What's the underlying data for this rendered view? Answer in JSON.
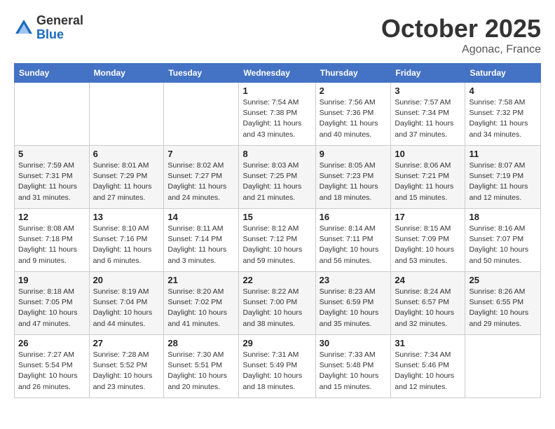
{
  "logo": {
    "general": "General",
    "blue": "Blue"
  },
  "title": {
    "month": "October 2025",
    "location": "Agonac, France"
  },
  "headers": [
    "Sunday",
    "Monday",
    "Tuesday",
    "Wednesday",
    "Thursday",
    "Friday",
    "Saturday"
  ],
  "weeks": [
    [
      {
        "day": "",
        "info": ""
      },
      {
        "day": "",
        "info": ""
      },
      {
        "day": "",
        "info": ""
      },
      {
        "day": "1",
        "info": "Sunrise: 7:54 AM\nSunset: 7:38 PM\nDaylight: 11 hours\nand 43 minutes."
      },
      {
        "day": "2",
        "info": "Sunrise: 7:56 AM\nSunset: 7:36 PM\nDaylight: 11 hours\nand 40 minutes."
      },
      {
        "day": "3",
        "info": "Sunrise: 7:57 AM\nSunset: 7:34 PM\nDaylight: 11 hours\nand 37 minutes."
      },
      {
        "day": "4",
        "info": "Sunrise: 7:58 AM\nSunset: 7:32 PM\nDaylight: 11 hours\nand 34 minutes."
      }
    ],
    [
      {
        "day": "5",
        "info": "Sunrise: 7:59 AM\nSunset: 7:31 PM\nDaylight: 11 hours\nand 31 minutes."
      },
      {
        "day": "6",
        "info": "Sunrise: 8:01 AM\nSunset: 7:29 PM\nDaylight: 11 hours\nand 27 minutes."
      },
      {
        "day": "7",
        "info": "Sunrise: 8:02 AM\nSunset: 7:27 PM\nDaylight: 11 hours\nand 24 minutes."
      },
      {
        "day": "8",
        "info": "Sunrise: 8:03 AM\nSunset: 7:25 PM\nDaylight: 11 hours\nand 21 minutes."
      },
      {
        "day": "9",
        "info": "Sunrise: 8:05 AM\nSunset: 7:23 PM\nDaylight: 11 hours\nand 18 minutes."
      },
      {
        "day": "10",
        "info": "Sunrise: 8:06 AM\nSunset: 7:21 PM\nDaylight: 11 hours\nand 15 minutes."
      },
      {
        "day": "11",
        "info": "Sunrise: 8:07 AM\nSunset: 7:19 PM\nDaylight: 11 hours\nand 12 minutes."
      }
    ],
    [
      {
        "day": "12",
        "info": "Sunrise: 8:08 AM\nSunset: 7:18 PM\nDaylight: 11 hours\nand 9 minutes."
      },
      {
        "day": "13",
        "info": "Sunrise: 8:10 AM\nSunset: 7:16 PM\nDaylight: 11 hours\nand 6 minutes."
      },
      {
        "day": "14",
        "info": "Sunrise: 8:11 AM\nSunset: 7:14 PM\nDaylight: 11 hours\nand 3 minutes."
      },
      {
        "day": "15",
        "info": "Sunrise: 8:12 AM\nSunset: 7:12 PM\nDaylight: 10 hours\nand 59 minutes."
      },
      {
        "day": "16",
        "info": "Sunrise: 8:14 AM\nSunset: 7:11 PM\nDaylight: 10 hours\nand 56 minutes."
      },
      {
        "day": "17",
        "info": "Sunrise: 8:15 AM\nSunset: 7:09 PM\nDaylight: 10 hours\nand 53 minutes."
      },
      {
        "day": "18",
        "info": "Sunrise: 8:16 AM\nSunset: 7:07 PM\nDaylight: 10 hours\nand 50 minutes."
      }
    ],
    [
      {
        "day": "19",
        "info": "Sunrise: 8:18 AM\nSunset: 7:05 PM\nDaylight: 10 hours\nand 47 minutes."
      },
      {
        "day": "20",
        "info": "Sunrise: 8:19 AM\nSunset: 7:04 PM\nDaylight: 10 hours\nand 44 minutes."
      },
      {
        "day": "21",
        "info": "Sunrise: 8:20 AM\nSunset: 7:02 PM\nDaylight: 10 hours\nand 41 minutes."
      },
      {
        "day": "22",
        "info": "Sunrise: 8:22 AM\nSunset: 7:00 PM\nDaylight: 10 hours\nand 38 minutes."
      },
      {
        "day": "23",
        "info": "Sunrise: 8:23 AM\nSunset: 6:59 PM\nDaylight: 10 hours\nand 35 minutes."
      },
      {
        "day": "24",
        "info": "Sunrise: 8:24 AM\nSunset: 6:57 PM\nDaylight: 10 hours\nand 32 minutes."
      },
      {
        "day": "25",
        "info": "Sunrise: 8:26 AM\nSunset: 6:55 PM\nDaylight: 10 hours\nand 29 minutes."
      }
    ],
    [
      {
        "day": "26",
        "info": "Sunrise: 7:27 AM\nSunset: 5:54 PM\nDaylight: 10 hours\nand 26 minutes."
      },
      {
        "day": "27",
        "info": "Sunrise: 7:28 AM\nSunset: 5:52 PM\nDaylight: 10 hours\nand 23 minutes."
      },
      {
        "day": "28",
        "info": "Sunrise: 7:30 AM\nSunset: 5:51 PM\nDaylight: 10 hours\nand 20 minutes."
      },
      {
        "day": "29",
        "info": "Sunrise: 7:31 AM\nSunset: 5:49 PM\nDaylight: 10 hours\nand 18 minutes."
      },
      {
        "day": "30",
        "info": "Sunrise: 7:33 AM\nSunset: 5:48 PM\nDaylight: 10 hours\nand 15 minutes."
      },
      {
        "day": "31",
        "info": "Sunrise: 7:34 AM\nSunset: 5:46 PM\nDaylight: 10 hours\nand 12 minutes."
      },
      {
        "day": "",
        "info": ""
      }
    ]
  ]
}
